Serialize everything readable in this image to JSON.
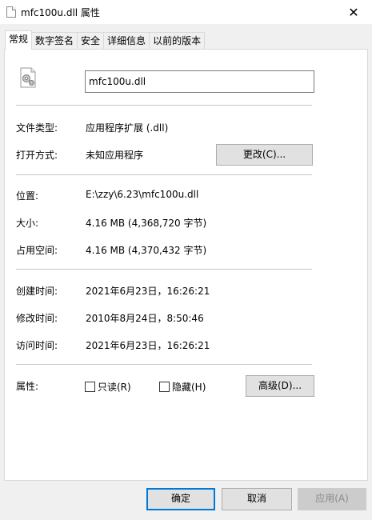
{
  "window": {
    "title": "mfc100u.dll 属性",
    "close_glyph": "✕"
  },
  "tabs": [
    {
      "label": "常规",
      "active": true
    },
    {
      "label": "数字签名",
      "active": false
    },
    {
      "label": "安全",
      "active": false
    },
    {
      "label": "详细信息",
      "active": false
    },
    {
      "label": "以前的版本",
      "active": false
    }
  ],
  "general": {
    "file_name": "mfc100u.dll",
    "file_type_label": "文件类型:",
    "file_type_value": "应用程序扩展 (.dll)",
    "open_with_label": "打开方式:",
    "open_with_value": "未知应用程序",
    "change_button": "更改(C)...",
    "location_label": "位置:",
    "location_value": "E:\\zzy\\6.23\\mfc100u.dll",
    "size_label": "大小:",
    "size_value": "4.16 MB (4,368,720 字节)",
    "size_on_disk_label": "占用空间:",
    "size_on_disk_value": "4.16 MB (4,370,432 字节)",
    "created_label": "创建时间:",
    "created_value": "2021年6月23日，16:26:21",
    "modified_label": "修改时间:",
    "modified_value": "2010年8月24日，8:50:46",
    "accessed_label": "访问时间:",
    "accessed_value": "2021年6月23日，16:26:21",
    "attributes_label": "属性:",
    "readonly_label": "只读(R)",
    "readonly_checked": false,
    "hidden_label": "隐藏(H)",
    "hidden_checked": false,
    "advanced_button": "高级(D)..."
  },
  "footer": {
    "ok_button": "确定",
    "cancel_button": "取消",
    "apply_button": "应用(A)"
  },
  "icons": {
    "file": "settings-file-icon",
    "close": "close-icon"
  }
}
